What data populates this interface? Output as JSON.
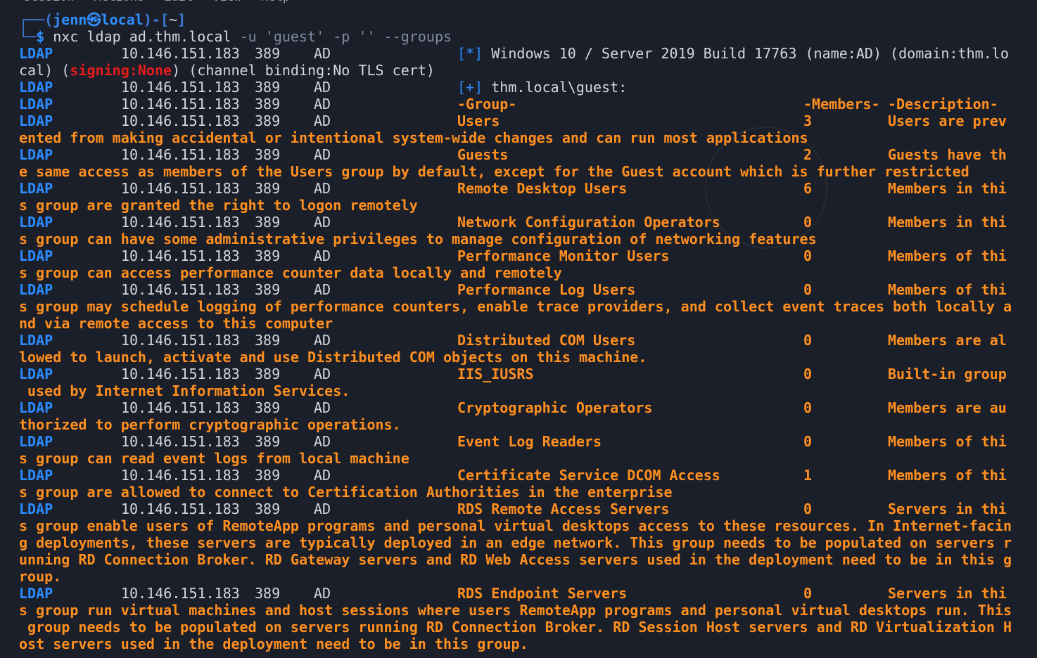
{
  "menubar": [
    "Session",
    "Actions",
    "Edit",
    "View",
    "Help"
  ],
  "prompt": {
    "open": "┌──(",
    "user": "jenn",
    "at": "㉿",
    "host": "local",
    "close": ")-[",
    "dir": "~",
    "end": "]",
    "arrow": "└─",
    "dollar": "$ ",
    "cmd": "nxc ldap ad.thm.local",
    "args": " -u 'guest' -p '' --groups"
  },
  "conn": {
    "proto": "LDAP",
    "ip": "10.146.151.183",
    "port": "389",
    "host": "AD"
  },
  "banner": {
    "tag": "[*]",
    "text": " Windows 10 / Server 2019 Build 17763 (name:AD) (domain:thm.lo",
    "cont1": "cal) (",
    "signing": "signing:None",
    "cont2": ") (channel binding:No TLS cert)"
  },
  "auth": {
    "tag": "[+]",
    "text": " thm.local\\guest:"
  },
  "headers": {
    "group": "-Group-",
    "members": "-Members-",
    "description": "-Description-"
  },
  "groups": [
    {
      "name": "Users",
      "members": "3",
      "desc": "Users are prev",
      "wrap": [
        "ented from making accidental or intentional system-wide changes and can run most applications"
      ]
    },
    {
      "name": "Guests",
      "members": "2",
      "desc": "Guests have th",
      "wrap": [
        "e same access as members of the Users group by default, except for the Guest account which is further restricted"
      ]
    },
    {
      "name": "Remote Desktop Users",
      "members": "6",
      "desc": "Members in thi",
      "wrap": [
        "s group are granted the right to logon remotely"
      ]
    },
    {
      "name": "Network Configuration Operators",
      "members": "0",
      "desc": "Members in thi",
      "wrap": [
        "s group can have some administrative privileges to manage configuration of networking features"
      ]
    },
    {
      "name": "Performance Monitor Users",
      "members": "0",
      "desc": "Members of thi",
      "wrap": [
        "s group can access performance counter data locally and remotely"
      ]
    },
    {
      "name": "Performance Log Users",
      "members": "0",
      "desc": "Members of thi",
      "wrap": [
        "s group may schedule logging of performance counters, enable trace providers, and collect event traces both locally a",
        "nd via remote access to this computer"
      ]
    },
    {
      "name": "Distributed COM Users",
      "members": "0",
      "desc": "Members are al",
      "wrap": [
        "lowed to launch, activate and use Distributed COM objects on this machine."
      ]
    },
    {
      "name": "IIS_IUSRS",
      "members": "0",
      "desc": "Built-in group",
      "wrap": [
        " used by Internet Information Services."
      ]
    },
    {
      "name": "Cryptographic Operators",
      "members": "0",
      "desc": "Members are au",
      "wrap": [
        "thorized to perform cryptographic operations."
      ]
    },
    {
      "name": "Event Log Readers",
      "members": "0",
      "desc": "Members of thi",
      "wrap": [
        "s group can read event logs from local machine"
      ]
    },
    {
      "name": "Certificate Service DCOM Access",
      "members": "1",
      "desc": "Members of thi",
      "wrap": [
        "s group are allowed to connect to Certification Authorities in the enterprise"
      ]
    },
    {
      "name": "RDS Remote Access Servers",
      "members": "0",
      "desc": "Servers in thi",
      "wrap": [
        "s group enable users of RemoteApp programs and personal virtual desktops access to these resources. In Internet-facin",
        "g deployments, these servers are typically deployed in an edge network. This group needs to be populated on servers r",
        "unning RD Connection Broker. RD Gateway servers and RD Web Access servers used in the deployment need to be in this g",
        "roup."
      ]
    },
    {
      "name": "RDS Endpoint Servers",
      "members": "0",
      "desc": "Servers in thi",
      "wrap": [
        "s group run virtual machines and host sessions where users RemoteApp programs and personal virtual desktops run. This",
        " group needs to be populated on servers running RD Connection Broker. RD Session Host servers and RD Virtualization H",
        "ost servers used in the deployment need to be in this group."
      ]
    }
  ],
  "colors": {
    "background": "#1b1f29",
    "ldap": "#2b8cff",
    "group_text": "#ff8f1f",
    "signing": "#e51c1c",
    "plain": "#d4d7de"
  }
}
